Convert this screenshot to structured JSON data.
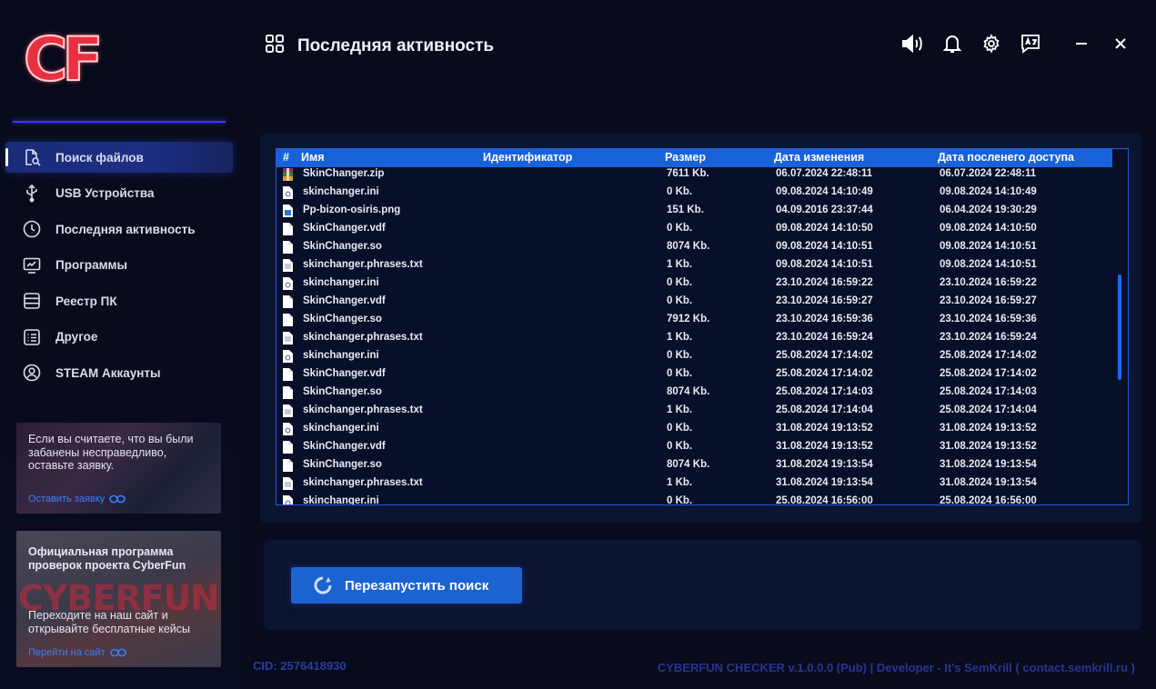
{
  "app": {
    "logo": "CF"
  },
  "sidebar": {
    "items": [
      {
        "label": "Поиск файлов",
        "icon": "file-search-icon",
        "active": true
      },
      {
        "label": "USB Устройства",
        "icon": "usb-icon"
      },
      {
        "label": "Последняя активность",
        "icon": "clock-icon"
      },
      {
        "label": "Программы",
        "icon": "monitor-icon"
      },
      {
        "label": "Реестр ПК",
        "icon": "database-icon"
      },
      {
        "label": "Другое",
        "icon": "list-icon"
      },
      {
        "label": "STEAM Аккаунты",
        "icon": "user-circle-icon"
      }
    ],
    "promo1": {
      "text": "Если вы считаете, что вы были забанены несправедливо, оставьте заявку.",
      "link": "Оставить заявку"
    },
    "promo2": {
      "title": "Официальная программа проверок проекта CyberFun",
      "watermark": "CYBERFUN",
      "text": "Переходите на наш сайт и открывайте бесплатные кейсы",
      "link": "Перейти на сайт"
    }
  },
  "header": {
    "title": "Последняя активность"
  },
  "table": {
    "columns": [
      "#",
      "Имя",
      "Идентификатор",
      "Размер",
      "Дата изменения",
      "Дата посленего доступа"
    ],
    "rows": [
      {
        "icon": "winrar",
        "name": "SkinChanger.zip",
        "size": "7611 Kb.",
        "modified": "06.07.2024 22:48:11",
        "accessed": "06.07.2024 22:48:11"
      },
      {
        "icon": "ini",
        "name": "skinchanger.ini",
        "size": "0 Kb.",
        "modified": "09.08.2024 14:10:49",
        "accessed": "09.08.2024 14:10:49"
      },
      {
        "icon": "png",
        "name": "Pp-bizon-osiris.png",
        "size": "151 Kb.",
        "modified": "04.09.2016 23:37:44",
        "accessed": "06.04.2024 19:30:29"
      },
      {
        "icon": "file",
        "name": "SkinChanger.vdf",
        "size": "0 Kb.",
        "modified": "09.08.2024 14:10:50",
        "accessed": "09.08.2024 14:10:50"
      },
      {
        "icon": "file",
        "name": "SkinChanger.so",
        "size": "8074 Kb.",
        "modified": "09.08.2024 14:10:51",
        "accessed": "09.08.2024 14:10:51"
      },
      {
        "icon": "txt",
        "name": "skinchanger.phrases.txt",
        "size": "1 Kb.",
        "modified": "09.08.2024 14:10:51",
        "accessed": "09.08.2024 14:10:51"
      },
      {
        "icon": "ini",
        "name": "skinchanger.ini",
        "size": "0 Kb.",
        "modified": "23.10.2024 16:59:22",
        "accessed": "23.10.2024 16:59:22"
      },
      {
        "icon": "file",
        "name": "SkinChanger.vdf",
        "size": "0 Kb.",
        "modified": "23.10.2024 16:59:27",
        "accessed": "23.10.2024 16:59:27"
      },
      {
        "icon": "file",
        "name": "SkinChanger.so",
        "size": "7912 Kb.",
        "modified": "23.10.2024 16:59:36",
        "accessed": "23.10.2024 16:59:36"
      },
      {
        "icon": "txt",
        "name": "skinchanger.phrases.txt",
        "size": "1 Kb.",
        "modified": "23.10.2024 16:59:24",
        "accessed": "23.10.2024 16:59:24"
      },
      {
        "icon": "ini",
        "name": "skinchanger.ini",
        "size": "0 Kb.",
        "modified": "25.08.2024 17:14:02",
        "accessed": "25.08.2024 17:14:02"
      },
      {
        "icon": "file",
        "name": "SkinChanger.vdf",
        "size": "0 Kb.",
        "modified": "25.08.2024 17:14:02",
        "accessed": "25.08.2024 17:14:02"
      },
      {
        "icon": "file",
        "name": "SkinChanger.so",
        "size": "8074 Kb.",
        "modified": "25.08.2024 17:14:03",
        "accessed": "25.08.2024 17:14:03"
      },
      {
        "icon": "txt",
        "name": "skinchanger.phrases.txt",
        "size": "1 Kb.",
        "modified": "25.08.2024 17:14:04",
        "accessed": "25.08.2024 17:14:04"
      },
      {
        "icon": "ini",
        "name": "skinchanger.ini",
        "size": "0 Kb.",
        "modified": "31.08.2024 19:13:52",
        "accessed": "31.08.2024 19:13:52"
      },
      {
        "icon": "file",
        "name": "SkinChanger.vdf",
        "size": "0 Kb.",
        "modified": "31.08.2024 19:13:52",
        "accessed": "31.08.2024 19:13:52"
      },
      {
        "icon": "file",
        "name": "SkinChanger.so",
        "size": "8074 Kb.",
        "modified": "31.08.2024 19:13:54",
        "accessed": "31.08.2024 19:13:54"
      },
      {
        "icon": "txt",
        "name": "skinchanger.phrases.txt",
        "size": "1 Kb.",
        "modified": "31.08.2024 19:13:54",
        "accessed": "31.08.2024 19:13:54"
      },
      {
        "icon": "ini",
        "name": "skinchanger.ini",
        "size": "0 Kb.",
        "modified": "25.08.2024 16:56:00",
        "accessed": "25.08.2024 16:56:00"
      }
    ]
  },
  "actions": {
    "restart_label": "Перезапустить поиск"
  },
  "status": {
    "cid": "CID: 2576418930",
    "footer": "CYBERFUN CHECKER v.1.0.0.0 (Pub) | Developer - It's SemKrill ( contact.semkrill.ru )"
  },
  "colors": {
    "accent": "#1c63d2",
    "header_bg": "#1762d8",
    "logo": "#e8303f"
  }
}
